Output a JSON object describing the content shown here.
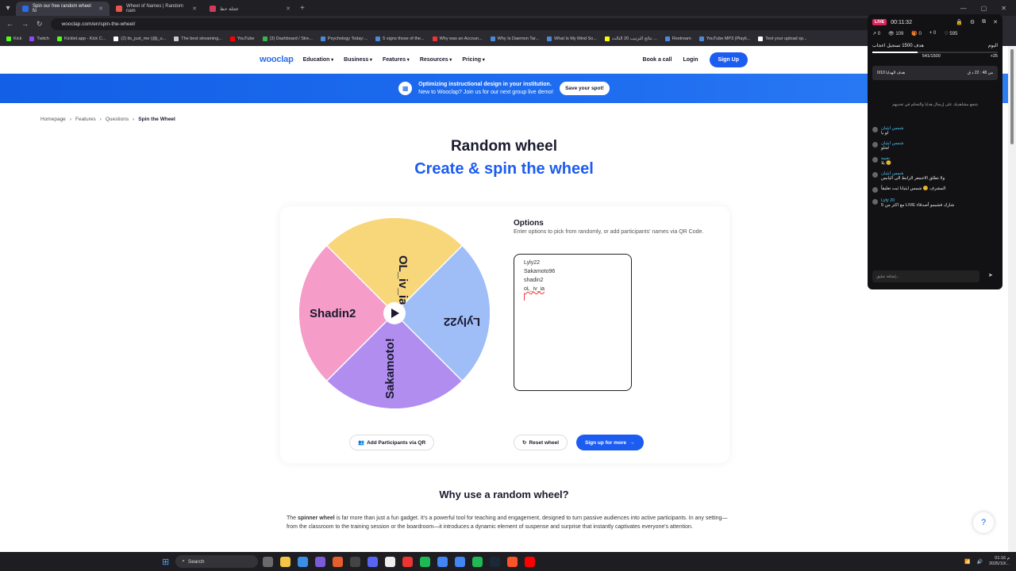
{
  "browser": {
    "tabs": [
      {
        "title": "Spin our free random wheel fo",
        "active": true,
        "color": "#2c6bea"
      },
      {
        "title": "Wheel of Names | Random nam",
        "active": false,
        "color": "#e8554e"
      },
      {
        "title": "عجلة حظ",
        "active": false,
        "color": "#d23a5b"
      }
    ],
    "url": "wooclap.com/en/spin-the-wheel/",
    "bookmarks": [
      "Kick",
      "Twitch",
      "Kicklet.app - Kick C...",
      "(2) its_just_me (@j_u...",
      "The best streaming...",
      "YouTube",
      "(3) Dashboard / Stre...",
      "Psychology Today:...",
      "5 signs those of the...",
      "Why was an Accoun...",
      "Why Is Daemon Tar...",
      "What Is My Mind So...",
      "نتائج الترتيب 20 الثالث ...",
      "Restream",
      "YouTube MP3 (Playli...",
      "Text your upload sp..."
    ]
  },
  "site": {
    "logo": "wooclap",
    "menu": [
      "Education",
      "Business",
      "Features",
      "Resources",
      "Pricing"
    ],
    "book_call": "Book a call",
    "login": "Login",
    "signup": "Sign Up",
    "banner": {
      "title": "Optimizing instructional design in your institution.",
      "subtitle": "New to Wooclap? Join us for our next group live demo!",
      "cta": "Save your spot!"
    },
    "breadcrumbs": [
      "Homepage",
      "Features",
      "Questions",
      "Spin the Wheel"
    ],
    "h1": "Random wheel",
    "h2": "Create & spin the wheel",
    "wheel": {
      "segments": [
        {
          "label": "OL_iv_ia",
          "color": "#f7d77a"
        },
        {
          "label": "Lyly22",
          "color": "#9fbdf7"
        },
        {
          "label": "Sakamoto!",
          "color": "#b18df0"
        },
        {
          "label": "Shadin2",
          "color": "#f59cc9"
        }
      ]
    },
    "options": {
      "title": "Options",
      "description": "Enter options to pick from randomly, or add participants' names via QR Code.",
      "entries": [
        "Lyly22",
        "Sakamoto96",
        "shadin2"
      ],
      "misspelled_entry": "oL_iv_ia"
    },
    "buttons": {
      "qr": "Add Participants via QR",
      "reset": "Reset wheel",
      "more": "Sign up for more"
    },
    "why_title": "Why use a random wheel?",
    "why_para_prefix": "The ",
    "why_para_bold": "spinner wheel",
    "why_para_rest": " is far more than just a fun gadget. It's a powerful tool for teaching and engagement, designed to turn passive audiences into active participants. In any setting—from the classroom to the training session or the boardroom—it introduces a dynamic element of suspense and surprise that instantly captivates everyone's attention.",
    "help": "?"
  },
  "live_panel": {
    "badge": "LIVE",
    "timer": "00:11:32",
    "stats": [
      "0",
      "109",
      "0",
      "0",
      "595"
    ],
    "goal_label": "هدف 1500 تسجيل اعجاب",
    "goal_side": "اليوم",
    "goal_current": "541/1500",
    "goal_plus": "+25",
    "gift_left": "0/10 هدف الهدايا",
    "gift_right": "من 48 : 22 د ق",
    "welcome": "شجع مشاهديك على إرسال هدايا والتحكم في تحديهم",
    "messages": [
      {
        "user": "شمس ايثيان",
        "text": "لو يا"
      },
      {
        "user": "شمس ايثيان",
        "text": "لحلو"
      },
      {
        "user": "نجمة",
        "text": "يلا 😊"
      },
      {
        "user": "شمس ايثيان",
        "text": "ولا تطلق الاجمعر الرابط الى اليابس"
      },
      {
        "user": "",
        "text": "المشرف 😊 شمس ايثيانا ثبت تعليقاً"
      },
      {
        "user": "Lyly 20",
        "text": "مع اكثر من 5 LIVE شارك فشيمو أصدقاء"
      }
    ],
    "input_placeholder": "إضافة تعليق..."
  },
  "taskbar": {
    "search": "Search",
    "time": "01:16 م",
    "date": "2025/10/..."
  }
}
